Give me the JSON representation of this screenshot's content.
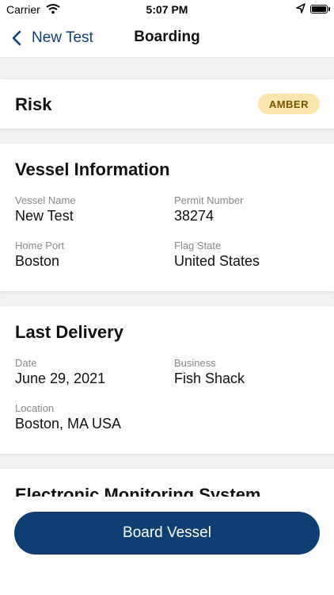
{
  "status_bar": {
    "carrier": "Carrier",
    "time": "5:07 PM"
  },
  "nav": {
    "back_label": "New Test",
    "title": "Boarding"
  },
  "risk": {
    "title": "Risk",
    "level": "AMBER",
    "level_color": "#fbe7ad"
  },
  "vessel_info": {
    "title": "Vessel Information",
    "fields": [
      {
        "label": "Vessel Name",
        "value": "New Test"
      },
      {
        "label": "Permit Number",
        "value": "38274"
      },
      {
        "label": "Home Port",
        "value": "Boston"
      },
      {
        "label": "Flag State",
        "value": "United States"
      }
    ]
  },
  "last_delivery": {
    "title": "Last Delivery",
    "fields": [
      {
        "label": "Date",
        "value": "June 29, 2021"
      },
      {
        "label": "Business",
        "value": "Fish Shack"
      },
      {
        "label": "Location",
        "value": "Boston, MA USA"
      }
    ]
  },
  "ems": {
    "title": "Electronic Monitoring System"
  },
  "actions": {
    "board_label": "Board Vessel"
  },
  "colors": {
    "primary": "#0f3f72",
    "badge_text": "#7a5300"
  }
}
